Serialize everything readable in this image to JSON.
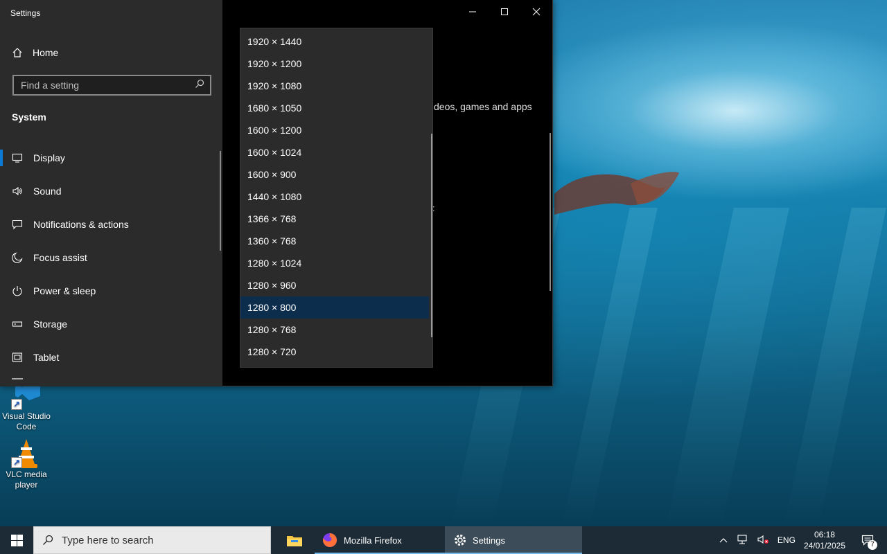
{
  "window": {
    "title": "Settings",
    "minimize_icon": "minimize-icon",
    "maximize_icon": "maximize-icon",
    "close_icon": "close-icon"
  },
  "sidebar": {
    "home_label": "Home",
    "search_placeholder": "Find a setting",
    "section_title": "System",
    "items": [
      {
        "label": "Display",
        "icon": "monitor-icon",
        "active": true
      },
      {
        "label": "Sound",
        "icon": "speaker-icon"
      },
      {
        "label": "Notifications & actions",
        "icon": "message-icon"
      },
      {
        "label": "Focus assist",
        "icon": "moon-icon"
      },
      {
        "label": "Power & sleep",
        "icon": "power-icon"
      },
      {
        "label": "Storage",
        "icon": "drive-icon"
      },
      {
        "label": "Tablet",
        "icon": "tablet-icon"
      }
    ]
  },
  "main": {
    "partial_text": "deos, games and apps",
    "partial_colon": ":"
  },
  "resolution_dropdown": {
    "options": [
      "1920 × 1440",
      "1920 × 1200",
      "1920 × 1080",
      "1680 × 1050",
      "1600 × 1200",
      "1600 × 1024",
      "1600 × 900",
      "1440 × 1080",
      "1366 × 768",
      "1360 × 768",
      "1280 × 1024",
      "1280 × 960",
      "1280 × 800",
      "1280 × 768",
      "1280 × 720"
    ],
    "selected": "1280 × 800"
  },
  "desktop_icons": [
    {
      "label": "Visual Studio Code",
      "icon": "vscode-icon"
    },
    {
      "label": "VLC media player",
      "icon": "vlc-icon"
    }
  ],
  "taskbar": {
    "search_placeholder": "Type here to search",
    "apps": [
      {
        "label": "",
        "icon": "file-explorer-icon"
      },
      {
        "label": "Mozilla Firefox",
        "icon": "firefox-icon"
      },
      {
        "label": "Settings",
        "icon": "gear-icon"
      }
    ],
    "language": "ENG",
    "time": "06:18",
    "date": "24/01/2025",
    "notification_count": "7"
  },
  "colors": {
    "accent": "#0a7ad6",
    "selected_item": "#0d2d4d",
    "sidebar_bg": "#2b2b2b",
    "taskbar_bg": "#1c2b36"
  }
}
